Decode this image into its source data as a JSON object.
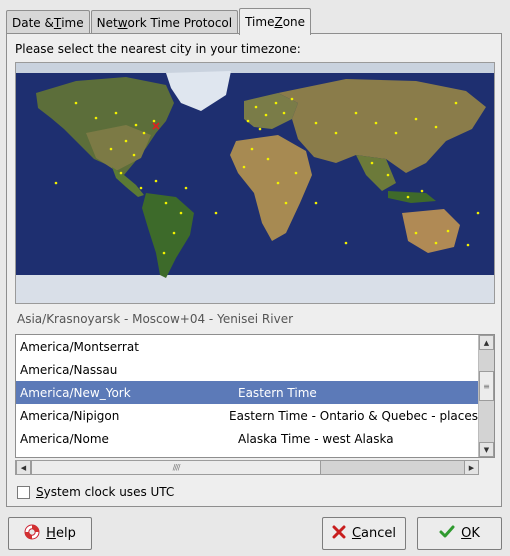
{
  "tabs": [
    {
      "label_pre": "Date & ",
      "label_u": "T",
      "label_post": "ime"
    },
    {
      "label_pre": "Net",
      "label_u": "w",
      "label_post": "ork Time Protocol"
    },
    {
      "label_pre": "Time ",
      "label_u": "Z",
      "label_post": "one"
    }
  ],
  "prompt": "Please select the nearest city in your timezone:",
  "selected_zone": "Asia/Krasnoyarsk - Moscow+04 - Yenisei River",
  "timezones": [
    {
      "name": "America/Montserrat",
      "comment": ""
    },
    {
      "name": "America/Nassau",
      "comment": ""
    },
    {
      "name": "America/New_York",
      "comment": "Eastern Time"
    },
    {
      "name": "America/Nipigon",
      "comment": "Eastern Time - Ontario & Quebec - places"
    },
    {
      "name": "America/Nome",
      "comment": "Alaska Time - west Alaska"
    }
  ],
  "utc": {
    "pre": "",
    "u": "S",
    "post": "ystem clock uses UTC"
  },
  "buttons": {
    "help": {
      "u": "H",
      "post": "elp"
    },
    "cancel": {
      "u": "C",
      "post": "ancel"
    },
    "ok": {
      "u": "O",
      "post": "K"
    }
  },
  "colors": {
    "selection": "#5c7ab8",
    "ocean": "#1e2f70",
    "city_dot": "#f2f200",
    "marker": "#e02020"
  },
  "icons": {
    "help": "lifebuoy-icon",
    "cancel": "x-icon",
    "ok": "checkmark-icon"
  }
}
